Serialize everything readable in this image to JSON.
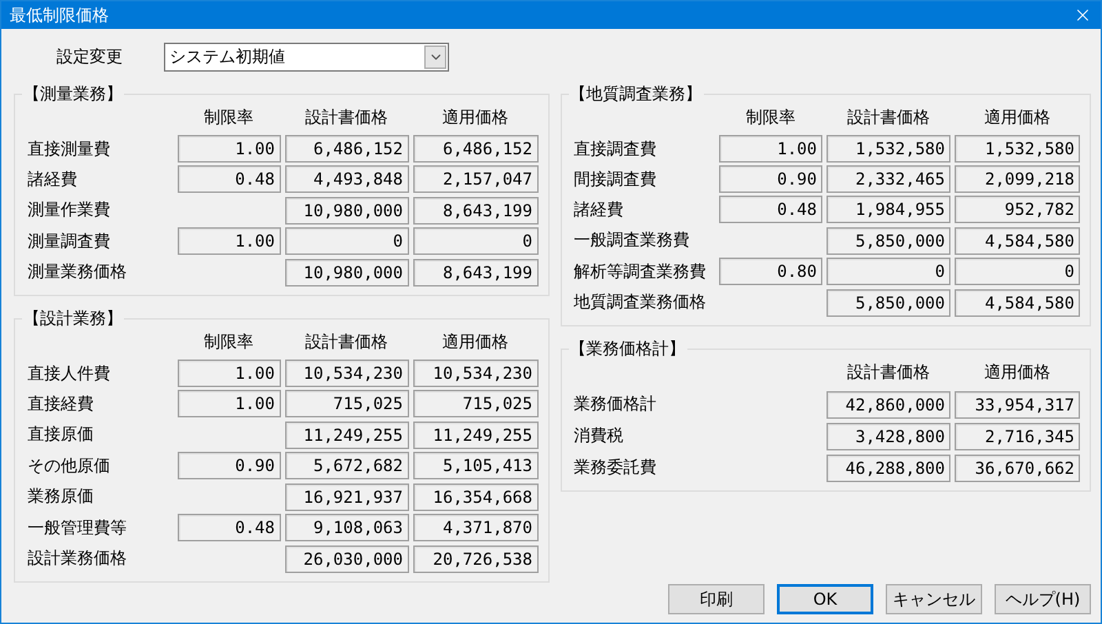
{
  "window": {
    "title": "最低制限価格"
  },
  "setting": {
    "label": "設定変更",
    "value": "システム初期値"
  },
  "left_groups": [
    {
      "legend": "【測量業務】",
      "columns": [
        "制限率",
        "設計書価格",
        "適用価格"
      ],
      "rows": [
        {
          "label": "直接測量費",
          "rate": "1.00",
          "design": "6,486,152",
          "applied": "6,486,152"
        },
        {
          "label": "諸経費",
          "rate": "0.48",
          "design": "4,493,848",
          "applied": "2,157,047"
        },
        {
          "label": "測量作業費",
          "design": "10,980,000",
          "applied": "8,643,199"
        },
        {
          "label": "測量調査費",
          "rate": "1.00",
          "design": "0",
          "applied": "0"
        },
        {
          "label": "測量業務価格",
          "design": "10,980,000",
          "applied": "8,643,199"
        }
      ]
    },
    {
      "legend": "【設計業務】",
      "columns": [
        "制限率",
        "設計書価格",
        "適用価格"
      ],
      "rows": [
        {
          "label": "直接人件費",
          "rate": "1.00",
          "design": "10,534,230",
          "applied": "10,534,230"
        },
        {
          "label": "直接経費",
          "rate": "1.00",
          "design": "715,025",
          "applied": "715,025"
        },
        {
          "label": "直接原価",
          "design": "11,249,255",
          "applied": "11,249,255"
        },
        {
          "label": "その他原価",
          "rate": "0.90",
          "design": "5,672,682",
          "applied": "5,105,413"
        },
        {
          "label": "業務原価",
          "design": "16,921,937",
          "applied": "16,354,668"
        },
        {
          "label": "一般管理費等",
          "rate": "0.48",
          "design": "9,108,063",
          "applied": "4,371,870"
        },
        {
          "label": "設計業務価格",
          "design": "26,030,000",
          "applied": "20,726,538"
        }
      ]
    }
  ],
  "right_groups": [
    {
      "legend": "【地質調査業務】",
      "columns": [
        "制限率",
        "設計書価格",
        "適用価格"
      ],
      "rows": [
        {
          "label": "直接調査費",
          "rate": "1.00",
          "design": "1,532,580",
          "applied": "1,532,580"
        },
        {
          "label": "間接調査費",
          "rate": "0.90",
          "design": "2,332,465",
          "applied": "2,099,218"
        },
        {
          "label": "諸経費",
          "rate": "0.48",
          "design": "1,984,955",
          "applied": "952,782"
        },
        {
          "label": "一般調査業務費",
          "design": "5,850,000",
          "applied": "4,584,580"
        },
        {
          "label": "解析等調査業務費",
          "rate": "0.80",
          "design": "0",
          "applied": "0"
        },
        {
          "label": "地質調査業務価格",
          "design": "5,850,000",
          "applied": "4,584,580"
        }
      ]
    },
    {
      "legend": "【業務価格計】",
      "columns": [
        "設計書価格",
        "適用価格"
      ],
      "rows": [
        {
          "label": "業務価格計",
          "design": "42,860,000",
          "applied": "33,954,317"
        },
        {
          "label": "消費税",
          "design": "3,428,800",
          "applied": "2,716,345"
        },
        {
          "label": "業務委託費",
          "design": "46,288,800",
          "applied": "36,670,662"
        }
      ]
    }
  ],
  "buttons": [
    {
      "label": "印刷",
      "default": false
    },
    {
      "label": "OK",
      "default": true
    },
    {
      "label": "キャンセル",
      "default": false
    },
    {
      "label": "ヘルプ(H)",
      "default": false
    }
  ]
}
